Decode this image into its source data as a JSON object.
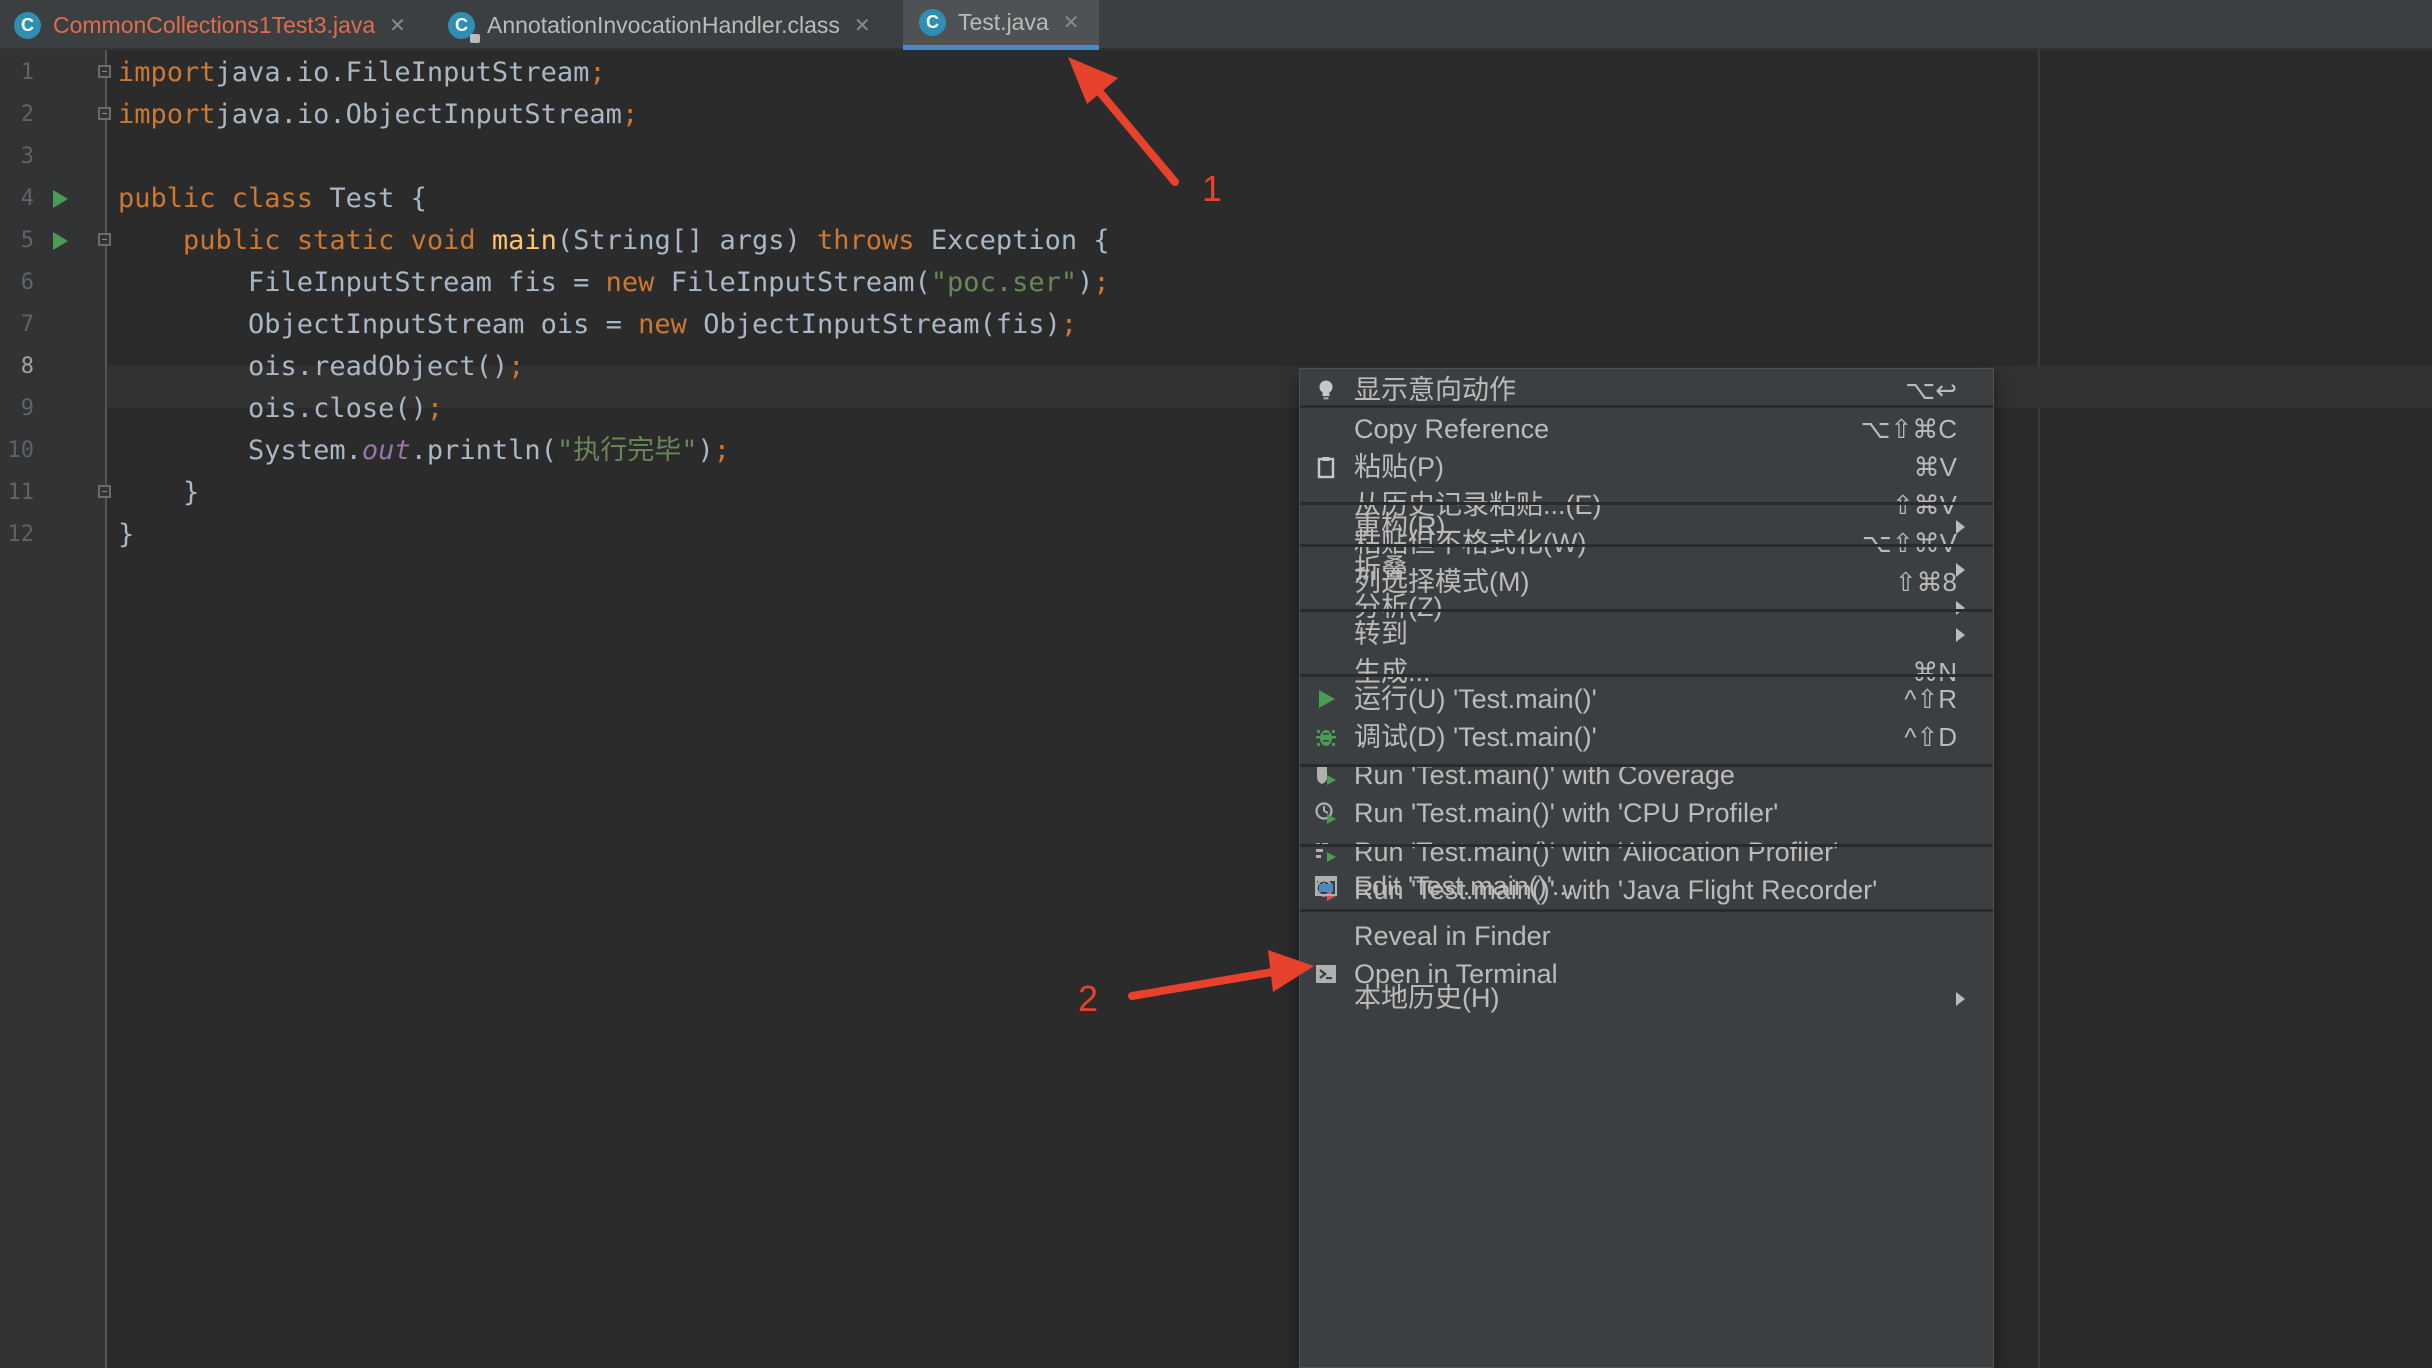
{
  "tabs": [
    {
      "label": "CommonCollections1Test3.java",
      "color": "#e06c4b",
      "icon": "java-class-icon",
      "close": "✕"
    },
    {
      "label": "AnnotationInvocationHandler.class",
      "color": "#bbbbbb",
      "icon": "java-class-locked-icon",
      "close": "✕"
    },
    {
      "label": "Test.java",
      "color": "#bbbbbb",
      "icon": "java-class-icon",
      "close": "✕",
      "active": true
    }
  ],
  "tab_icon_letter": "C",
  "editor": {
    "current_line": 8,
    "lines": [
      {
        "n": "1",
        "segs": [
          [
            "kw",
            "import"
          ],
          [
            "",
            "java.io.FileInputStream"
          ],
          [
            "kw",
            ";"
          ]
        ]
      },
      {
        "n": "2",
        "segs": [
          [
            "kw",
            "import"
          ],
          [
            "",
            "java.io.ObjectInputStream"
          ],
          [
            "kw",
            ";"
          ]
        ]
      },
      {
        "n": "3",
        "segs": []
      },
      {
        "n": "4",
        "segs": [
          [
            "kw",
            "public class "
          ],
          [
            "",
            "Test {"
          ]
        ]
      },
      {
        "n": "5",
        "segs": [
          [
            "",
            "    "
          ],
          [
            "kw",
            "public static void "
          ],
          [
            "fn",
            "main"
          ],
          [
            "",
            "(String[] args) "
          ],
          [
            "kw",
            "throws "
          ],
          [
            "",
            "Exception {"
          ]
        ]
      },
      {
        "n": "6",
        "segs": [
          [
            "",
            "        FileInputStream fis = "
          ],
          [
            "kw",
            "new "
          ],
          [
            "",
            "FileInputStream("
          ],
          [
            "str",
            "\"poc.ser\""
          ],
          [
            "",
            ")"
          ],
          [
            "kw",
            ";"
          ]
        ]
      },
      {
        "n": "7",
        "segs": [
          [
            "",
            "        ObjectInputStream ois = "
          ],
          [
            "kw",
            "new "
          ],
          [
            "",
            "ObjectInputStream(fis)"
          ],
          [
            "kw",
            ";"
          ]
        ]
      },
      {
        "n": "8",
        "segs": [
          [
            "",
            "        ois.readObject()"
          ],
          [
            "kw",
            ";"
          ]
        ]
      },
      {
        "n": "9",
        "segs": [
          [
            "",
            "        ois.close()"
          ],
          [
            "kw",
            ";"
          ]
        ]
      },
      {
        "n": "10",
        "segs": [
          [
            "",
            "        System."
          ],
          [
            "fld",
            "out"
          ],
          [
            "",
            ".println("
          ],
          [
            "str",
            "\"执行完毕\""
          ],
          [
            "",
            ")"
          ],
          [
            "kw",
            ";"
          ]
        ]
      },
      {
        "n": "11",
        "segs": [
          [
            "",
            "    }"
          ]
        ]
      },
      {
        "n": "12",
        "segs": [
          [
            "",
            "}"
          ]
        ]
      }
    ]
  },
  "context_menu": {
    "groups": [
      [
        {
          "label": "显示意向动作",
          "shortcut": "⌥↩",
          "icon": "lightbulb-icon"
        }
      ],
      [
        {
          "label": "Copy Reference",
          "shortcut": "⌥⇧⌘C"
        },
        {
          "label": "粘贴(P)",
          "shortcut": "⌘V",
          "icon": "clipboard-icon"
        },
        {
          "label": "从历史记录粘贴...(E)",
          "shortcut": "⇧⌘V"
        },
        {
          "label": "粘贴但不格式化(W)",
          "shortcut": "⌥⇧⌘V"
        },
        {
          "label": "列选择模式(M)",
          "shortcut": "⇧⌘8"
        }
      ],
      [
        {
          "label": "重构(R)",
          "submenu": true
        }
      ],
      [
        {
          "label": "折叠",
          "submenu": true
        },
        {
          "label": "分析(Z)",
          "submenu": true
        }
      ],
      [
        {
          "label": "转到",
          "submenu": true
        },
        {
          "label": "生成...",
          "shortcut": "⌘N"
        }
      ],
      [
        {
          "label": "运行(U) 'Test.main()'",
          "shortcut": "^⇧R",
          "icon": "run-icon"
        },
        {
          "label": "调试(D) 'Test.main()'",
          "shortcut": "^⇧D",
          "icon": "debug-icon"
        },
        {
          "label": "Run 'Test.main()' with Coverage",
          "icon": "coverage-icon"
        },
        {
          "label": "Run 'Test.main()' with 'CPU Profiler'",
          "icon": "cpu-profiler-icon"
        },
        {
          "label": "Run 'Test.main()' with 'Allocation Profiler'",
          "icon": "allocation-profiler-icon"
        },
        {
          "label": "Run 'Test.main()' with 'Java Flight Recorder'",
          "icon": "flight-recorder-icon"
        }
      ],
      [
        {
          "label": "Edit 'Test.main()'...",
          "icon": "edit-config-icon"
        }
      ],
      [
        {
          "label": "Reveal in Finder"
        },
        {
          "label": "Open in Terminal",
          "icon": "terminal-icon"
        }
      ],
      [
        {
          "label": "本地历史(H)",
          "submenu": true
        }
      ]
    ]
  },
  "annotations": [
    {
      "label": "1",
      "color": "#e8412c"
    },
    {
      "label": "2",
      "color": "#e8412c"
    }
  ],
  "colors": {
    "background": "#2b2b2b",
    "menu_background": "#3c3f41",
    "keyword": "#cc7832",
    "string": "#6a8759",
    "method": "#ffc66d",
    "run_green": "#499c54",
    "annotation_red": "#e8412c"
  }
}
